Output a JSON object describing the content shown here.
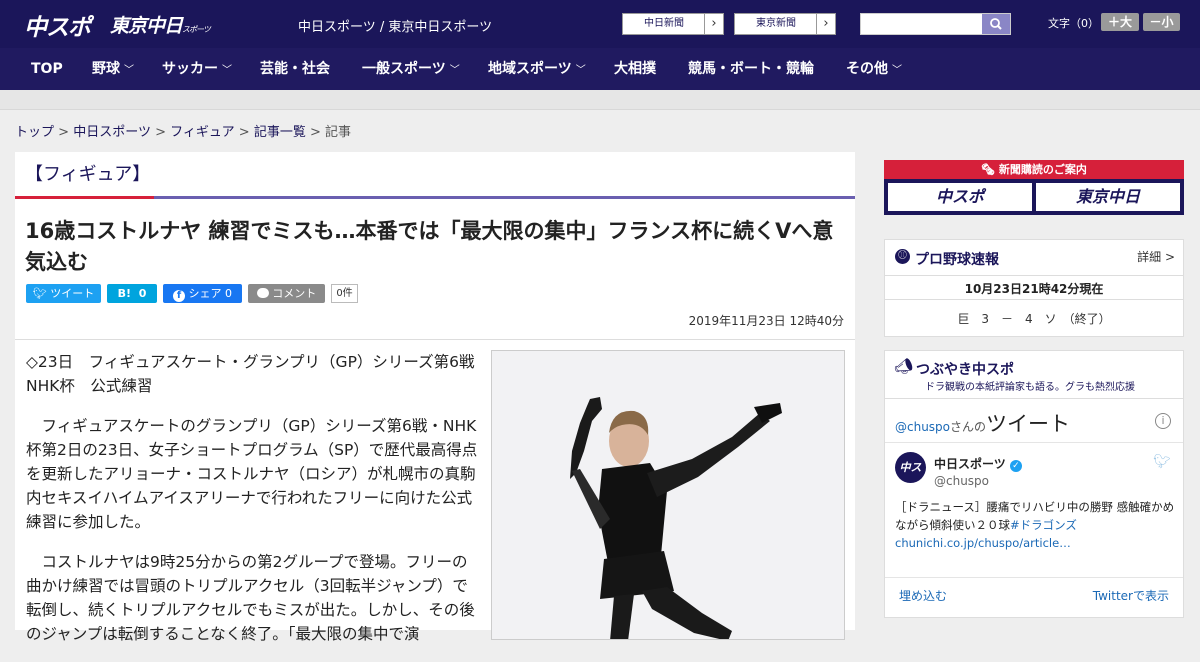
{
  "header": {
    "logo_main": "中スポ",
    "logo_tokyo": "東京中日",
    "logo_tokyo_sub": "スポーツ",
    "site_name": "中日スポーツ / 東京中日スポーツ",
    "paper1": "中日新聞",
    "paper2": "東京新聞",
    "search_placeholder": "",
    "font_label": "文字（0）",
    "font_large": "＋大",
    "font_small": "－小"
  },
  "nav": {
    "items": [
      "TOP",
      "野球",
      "サッカー",
      "芸能・社会",
      "一般スポーツ",
      "地域スポーツ",
      "大相撲",
      "競馬・ボート・競輪",
      "その他"
    ],
    "chevron": "﹀"
  },
  "breadcrumb": {
    "items": [
      "トップ",
      "中日スポーツ",
      "フィギュア",
      "記事一覧"
    ],
    "current": "記事",
    "sep": ">"
  },
  "article": {
    "category": "【フィギュア】",
    "headline": "16歳コストルナヤ 練習でミスも…本番では「最大限の集中」フランス杯に続くVへ意気込む",
    "share": {
      "tweet": "ツイート",
      "hatena": "B!",
      "hatena_count": "0",
      "facebook": "シェア",
      "facebook_count": "0",
      "comment": "コメント",
      "comment_count": "0件"
    },
    "date": "2019年11月23日 12時40分",
    "paragraphs": [
      "◇23日　フィギュアスケート・グランプリ（GP）シリーズ第6戦NHK杯　公式練習",
      "　フィギュアスケートのグランプリ（GP）シリーズ第6戦・NHK杯第2日の23日、女子ショートプログラム（SP）で歴代最高得点を更新したアリョーナ・コストルナヤ（ロシア）が札幌市の真駒内セキスイハイムアイスアリーナで行われたフリーに向けた公式練習に参加した。",
      "　コストルナヤは9時25分からの第2グループで登場。フリーの曲かけ練習では冒頭のトリプルアクセル（3回転半ジャンプ）で転倒し、続くトリプルアクセルでもミスが出た。しかし、その後のジャンプは転倒することなく終了。「最大限の集中で演"
    ]
  },
  "sidebar": {
    "subscribe_header": "新聞購読のご案内",
    "subscribe_a": "中スポ",
    "subscribe_b": "東京中日",
    "baseball": {
      "title": "プロ野球速報",
      "detail": "詳細 >",
      "time": "10月23日21時42分現在",
      "score": "巨　3　－　4　ソ　（終了）"
    },
    "tweets": {
      "title": "つぶやき中スポ",
      "subtitle": "ドラ観戦の本紙評論家も語る。グラも熱烈応援",
      "handle_link": "@chuspo",
      "handle_suffix": "さんの",
      "tweet_word": "ツイート",
      "account_name": "中日スポーツ",
      "account_handle": "@chuspo",
      "tweet_text": "［ドラニュース］腰痛でリハビリ中の勝野 感触確かめながら傾斜使い２０球",
      "hashtag": "#ドラゴンズ",
      "link": "chunichi.co.jp/chuspo/article…",
      "embed": "埋め込む",
      "view_on": "Twitterで表示"
    }
  },
  "colors": {
    "brand_navy": "#1b165a",
    "accent_red": "#d6203a",
    "twitter": "#1da1f2",
    "hatena": "#00a4de",
    "facebook": "#1877f2"
  }
}
